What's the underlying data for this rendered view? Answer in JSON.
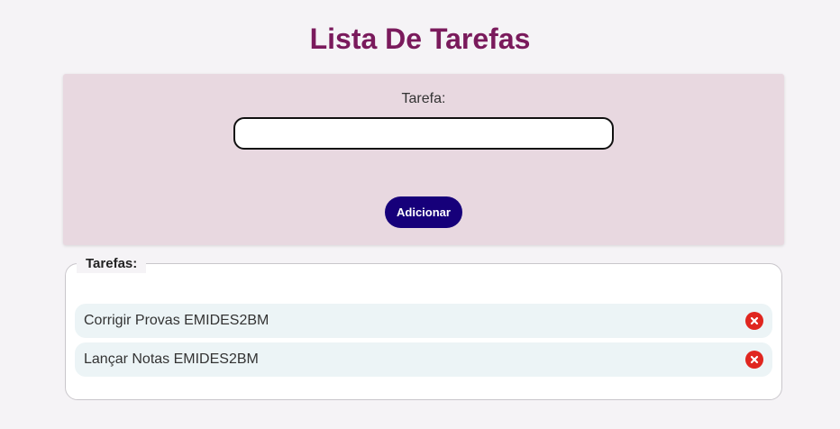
{
  "page": {
    "title": "Lista De Tarefas"
  },
  "form": {
    "task_label": "Tarefa:",
    "task_input_value": "",
    "add_button_label": "Adicionar"
  },
  "tasks": {
    "legend": "Tarefas:",
    "items": [
      {
        "text": "Corrigir Provas EMIDES2BM",
        "delete_icon": "close-circle-icon"
      },
      {
        "text": "Lançar Notas EMIDES2BM",
        "delete_icon": "close-circle-icon"
      }
    ]
  },
  "colors": {
    "title": "#7a1a5c",
    "panel_bg": "#e8d8e0",
    "button_bg": "#16007a",
    "task_item_bg": "#ecf4f6",
    "delete_icon": "#e0261f"
  }
}
